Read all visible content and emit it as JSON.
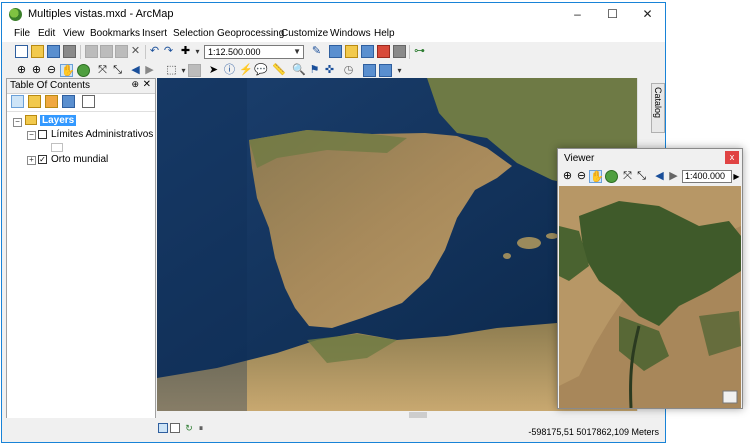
{
  "window": {
    "title": "Multiples vistas.mxd - ArcMap",
    "minimize": "–",
    "maximize": "☐",
    "close": "✕"
  },
  "menu": [
    "File",
    "Edit",
    "View",
    "Bookmarks",
    "Insert",
    "Selection",
    "Geoprocessing",
    "Customize",
    "Windows",
    "Help"
  ],
  "toolbar": {
    "scale": "1:12.500.000"
  },
  "toc": {
    "title": "Table Of Contents",
    "pin": "⊕",
    "close": "✕",
    "root": "Layers",
    "layers": [
      {
        "name": "Límites Administrativos",
        "checked": false
      },
      {
        "name": "Orto mundial",
        "checked": true
      }
    ]
  },
  "catalog_tab": "Catalog",
  "status": {
    "coordinates": "-598175,51  5017862,109 Meters"
  },
  "viewer": {
    "title": "Viewer",
    "scale": "1:400.000",
    "close": "x"
  },
  "colors": {
    "selection": "#3399ff",
    "window_border": "#1883d7",
    "viewer_close": "#e04343"
  }
}
